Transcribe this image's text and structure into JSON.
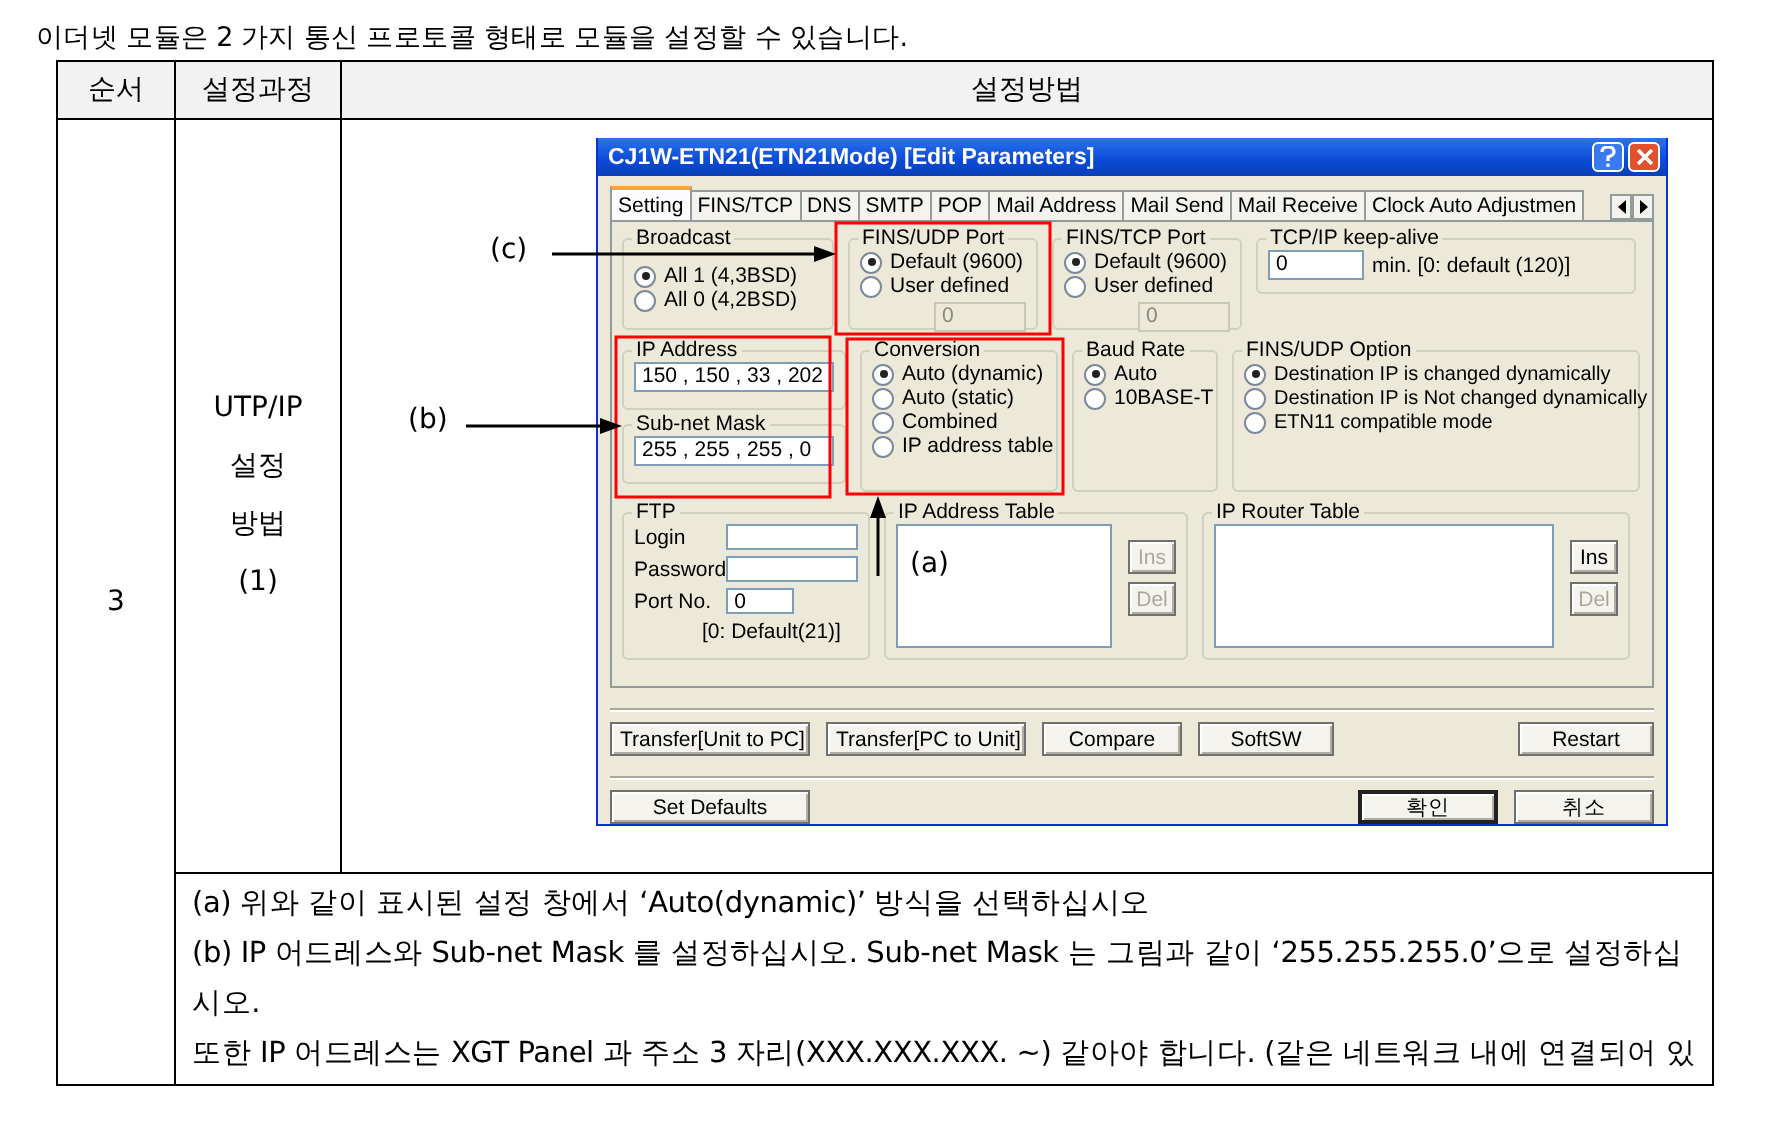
{
  "intro": "이더넷 모듈은 2 가지 통신 프로토콜 형태로 모듈을 설정할 수 있습니다.",
  "table": {
    "columns": [
      "순서",
      "설정과정",
      "설정방법"
    ],
    "step": "3",
    "process": [
      "UTP/IP",
      "설정",
      "방법",
      "(1)"
    ]
  },
  "dialog": {
    "title": "CJ1W-ETN21(ETN21Mode) [Edit Parameters]",
    "tabs": [
      {
        "label": "Setting",
        "selected": true
      },
      {
        "label": "FINS/TCP",
        "selected": false
      },
      {
        "label": "DNS",
        "selected": false
      },
      {
        "label": "SMTP",
        "selected": false
      },
      {
        "label": "POP",
        "selected": false
      },
      {
        "label": "Mail Address",
        "selected": false
      },
      {
        "label": "Mail Send",
        "selected": false
      },
      {
        "label": "Mail Receive",
        "selected": false
      },
      {
        "label": "Clock Auto Adjustmen",
        "selected": false
      }
    ],
    "broadcast": {
      "title": "Broadcast",
      "options": [
        {
          "label": "All 1 (4,3BSD)",
          "selected": true
        },
        {
          "label": "All 0 (4,2BSD)",
          "selected": false
        }
      ]
    },
    "fins_udp_port": {
      "title": "FINS/UDP Port",
      "options": [
        {
          "label": "Default (9600)",
          "selected": true
        },
        {
          "label": "User defined",
          "selected": false
        }
      ],
      "value": "0",
      "disabled": true
    },
    "fins_tcp_port": {
      "title": "FINS/TCP Port",
      "options": [
        {
          "label": "Default (9600)",
          "selected": true
        },
        {
          "label": "User defined",
          "selected": false
        }
      ],
      "value": "0",
      "disabled": true
    },
    "keep_alive": {
      "title": "TCP/IP keep-alive",
      "value": "0",
      "hint": "min.  [0: default (120)]"
    },
    "ip_address": {
      "title": "IP Address",
      "value": "150 , 150 , 33 , 202"
    },
    "subnet_mask": {
      "title": "Sub-net Mask",
      "value": "255 , 255 , 255 , 0"
    },
    "conversion": {
      "title": "Conversion",
      "options": [
        {
          "label": "Auto (dynamic)",
          "selected": true
        },
        {
          "label": "Auto (static)",
          "selected": false
        },
        {
          "label": "Combined",
          "selected": false
        },
        {
          "label": "IP address table",
          "selected": false
        }
      ]
    },
    "baud_rate": {
      "title": "Baud Rate",
      "options": [
        {
          "label": "Auto",
          "selected": true
        },
        {
          "label": "10BASE-T",
          "selected": false
        }
      ]
    },
    "fins_udp_option": {
      "title": "FINS/UDP Option",
      "options": [
        {
          "label": "Destination IP is changed dynamically",
          "selected": true
        },
        {
          "label": "Destination IP is Not changed dynamically",
          "selected": false
        },
        {
          "label": "ETN11 compatible mode",
          "selected": false
        }
      ]
    },
    "ftp": {
      "title": "FTP",
      "fields": [
        {
          "label": "Login"
        },
        {
          "label": "Password"
        },
        {
          "label": "Port No.",
          "value": "0"
        }
      ],
      "hint": "[0: Default(21)]"
    },
    "ip_address_table": {
      "title": "IP Address Table",
      "buttons": [
        {
          "label": "Ins",
          "disabled": true
        },
        {
          "label": "Del",
          "disabled": true
        }
      ]
    },
    "ip_router_table": {
      "title": "IP Router Table",
      "buttons": [
        {
          "label": "Ins",
          "disabled": false
        },
        {
          "label": "Del",
          "disabled": true
        }
      ]
    },
    "actions": [
      "Transfer[Unit to PC]",
      "Transfer[PC to Unit]",
      "Compare",
      "SoftSW",
      "Restart"
    ],
    "set_defaults": "Set Defaults",
    "footer_buttons": [
      {
        "label": "확인",
        "default": true
      },
      {
        "label": "취소",
        "default": false
      }
    ]
  },
  "annotations": [
    {
      "label": "(c)"
    },
    {
      "label": "(b)"
    },
    {
      "label": "(a)"
    }
  ],
  "notes": [
    "(a) 위와 같이 표시된 설정 창에서 ‘Auto(dynamic)’ 방식을 선택하십시오",
    "(b) IP 어드레스와 Sub-net Mask 를 설정하십시오. Sub-net Mask 는 그림과 같이 ‘255.255.255.0’으로 설정하십시오.",
    "또한 IP 어드레스는 XGT Panel 과 주소 3 자리(XXX.XXX.XXX. ~) 같아야 합니다. (같은 네트워크 내에 연결되어 있"
  ]
}
